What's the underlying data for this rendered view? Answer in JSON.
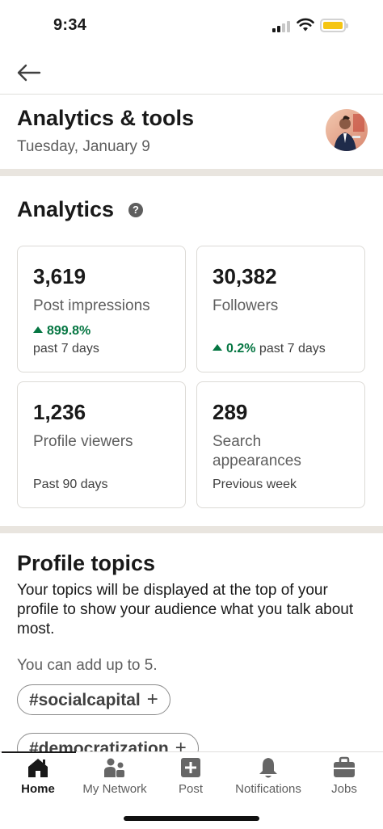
{
  "status_bar": {
    "time": "9:34"
  },
  "header": {
    "title": "Analytics & tools",
    "date": "Tuesday, January 9"
  },
  "analytics": {
    "title": "Analytics",
    "help_icon": "?",
    "cards": [
      {
        "value": "3,619",
        "label": "Post impressions",
        "change": "899.8%",
        "period": "past 7 days"
      },
      {
        "value": "30,382",
        "label": "Followers",
        "change": "0.2%",
        "period": "past 7 days"
      },
      {
        "value": "1,236",
        "label": "Profile viewers",
        "period": "Past 90 days"
      },
      {
        "value": "289",
        "label": "Search appearances",
        "period": "Previous week"
      }
    ]
  },
  "profile_topics": {
    "title": "Profile topics",
    "description": "Your topics will be displayed at the top of your profile to show your audience what you talk about most.",
    "limit_note": "You can add up to 5.",
    "chips": [
      {
        "label": "#socialcapital",
        "action": "+"
      },
      {
        "label": "#democratization",
        "action": "+"
      }
    ]
  },
  "bottom_nav": {
    "active": "Home",
    "items": [
      {
        "label": "Home",
        "icon": "home-icon"
      },
      {
        "label": "My Network",
        "icon": "network-icon"
      },
      {
        "label": "Post",
        "icon": "post-icon"
      },
      {
        "label": "Notifications",
        "icon": "bell-icon"
      },
      {
        "label": "Jobs",
        "icon": "briefcase-icon"
      }
    ]
  },
  "colors": {
    "positive": "#057642",
    "battery": "#f5c512",
    "divider": "#e9e5df"
  }
}
